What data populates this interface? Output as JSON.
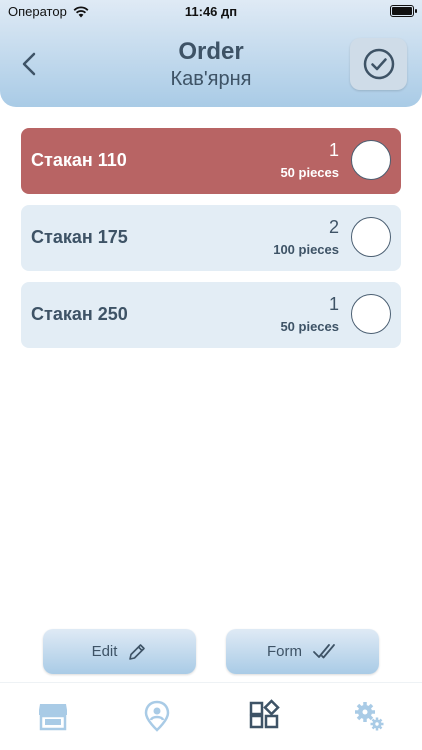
{
  "status": {
    "carrier": "Оператор",
    "time": "11:46 дп"
  },
  "header": {
    "title": "Order",
    "subtitle": "Кав'ярня"
  },
  "items": [
    {
      "name": "Стакан 110",
      "qty": "1",
      "pieces": "50 pieces",
      "active": true
    },
    {
      "name": "Стакан 175",
      "qty": "2",
      "pieces": "100 pieces",
      "active": false
    },
    {
      "name": "Стакан 250",
      "qty": "1",
      "pieces": "50 pieces",
      "active": false
    }
  ],
  "actions": {
    "edit_label": "Edit",
    "form_label": "Form"
  },
  "tabbar": {
    "tabs": [
      "store-icon",
      "location-icon",
      "catalog-icon",
      "settings-icon"
    ],
    "active_index": 2
  },
  "colors": {
    "accent": "#3e5366",
    "active_item": "#b86464",
    "item_bg": "#e3edf5",
    "inactive_tab": "#a9cbe6"
  }
}
